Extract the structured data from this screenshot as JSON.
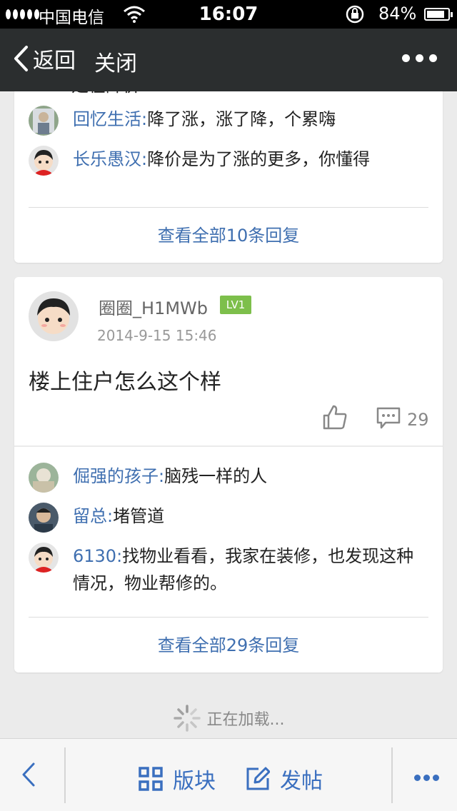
{
  "status": {
    "carrier": "中国电信",
    "time": "16:07",
    "battery": "84%",
    "battery_level": 0.84
  },
  "nav": {
    "back_label": "返回",
    "close_label": "关闭"
  },
  "prev_card": {
    "partial_text": "是在降价",
    "replies": [
      {
        "name": "回忆生活:",
        "text": "降了涨，涨了降，个累嗨"
      },
      {
        "name": "长乐愚汉:",
        "text": "降价是为了涨的更多，你懂得"
      }
    ],
    "view_all": "查看全部10条回复"
  },
  "post": {
    "username": "圈圈_H1MWb",
    "level": "LV1",
    "time": "2014-9-15 15:46",
    "body": "楼上住户怎么这个样",
    "comment_count": "29",
    "replies": [
      {
        "name": "倔强的孩子:",
        "text": "脑残一样的人"
      },
      {
        "name": "留总:",
        "text": "堵管道"
      },
      {
        "name": "6130:",
        "text": "找物业看看，我家在装修，也发现这种情况，物业帮修的。"
      }
    ],
    "view_all": "查看全部29条回复"
  },
  "loading_text": "正在加载...",
  "toolbar": {
    "board_label": "版块",
    "post_label": "发帖"
  },
  "colors": {
    "link": "#3f6fb0",
    "accent": "#3a6fbf",
    "level_badge": "#7dbf4b",
    "navbar": "#2b2e2f"
  }
}
